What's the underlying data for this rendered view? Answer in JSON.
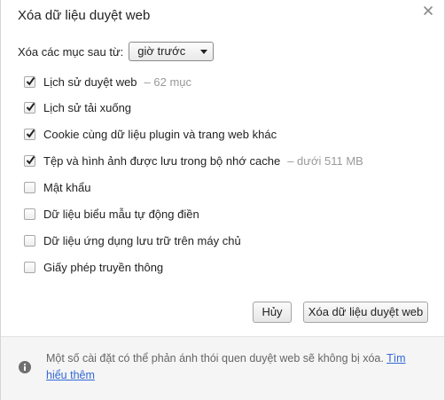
{
  "dialog": {
    "title": "Xóa dữ liệu duyệt web",
    "close_icon": "close-icon"
  },
  "range": {
    "label": "Xóa các mục sau từ:",
    "selected": "giờ trước"
  },
  "options": [
    {
      "label": "Lịch sử duyệt web",
      "note": "–  62 mục",
      "checked": true
    },
    {
      "label": "Lịch sử tải xuống",
      "note": "",
      "checked": true
    },
    {
      "label": "Cookie cùng dữ liệu plugin và trang web khác",
      "note": "",
      "checked": true
    },
    {
      "label": "Tệp và hình ảnh được lưu trong bộ nhớ cache",
      "note": "–  dưới 511 MB",
      "checked": true
    },
    {
      "label": "Mật khẩu",
      "note": "",
      "checked": false
    },
    {
      "label": "Dữ liệu biểu mẫu tự động điền",
      "note": "",
      "checked": false
    },
    {
      "label": "Dữ liệu ứng dụng lưu trữ trên máy chủ",
      "note": "",
      "checked": false
    },
    {
      "label": "Giấy phép truyền thông",
      "note": "",
      "checked": false
    }
  ],
  "buttons": {
    "cancel": "Hủy",
    "clear": "Xóa dữ liệu duyệt web"
  },
  "footer": {
    "text": "Một số cài đặt có thể phản ánh thói quen duyệt web sẽ không bị xóa.",
    "link": "Tìm hiểu thêm",
    "icon": "info-icon"
  },
  "colors": {
    "link": "#3367d6",
    "muted": "#999999"
  }
}
